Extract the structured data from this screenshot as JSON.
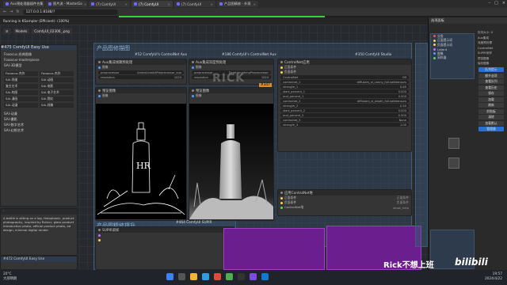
{
  "browser": {
    "tabs": [
      {
        "label": "Aux预处理器插件合集"
      },
      {
        "label": "图片流 - MasterGo"
      },
      {
        "label": "(7) ComfyUI"
      },
      {
        "label": "(7) ComfyUI",
        "active": true
      },
      {
        "label": "(7) ComfyUI"
      },
      {
        "label": "产品图精修 - 外观"
      }
    ],
    "url": "127.0.0.1:8188/?"
  },
  "app": {
    "title_line": "Running in KSampler (Efficient): (100%)",
    "model_label": "Models",
    "model_value": "ComfyUI_02306_.png"
  },
  "canvas": {
    "group_main": "产品图修描图",
    "group_bottom": "产品图精修提升",
    "node_475": "#475 ComfyUI Easy Use",
    "node_472": "#472 ComfyUI Easy Use",
    "node_52": "#52 ComfyUI's ControlNet Aux",
    "node_52_title": "Aux集成线稿预处理",
    "node_52_fields": [
      {
        "name": "图像",
        "value": ""
      },
      {
        "name": "preprocessor",
        "value": "AnimeLineArtPreprocessor_aux"
      },
      {
        "name": "resolution",
        "value": "1024"
      }
    ],
    "node_186": "#186 ComfyUI's ControlNet Aux",
    "node_186_title": "Aux集成深度预处理",
    "node_186_fields": [
      {
        "name": "图像",
        "value": ""
      },
      {
        "name": "preprocessor",
        "value": "DepthAnythingPreprocessor"
      },
      {
        "name": "resolution",
        "value": "1024"
      }
    ],
    "preview_title": "预览图像",
    "preview_title2": "预览图像",
    "preview_label": "图像",
    "node_350": "#350 ComfyUI Studio",
    "node_350_title": "ControlNet应用",
    "node_350_fields": [
      {
        "name": "正面条件",
        "value": ""
      },
      {
        "name": "负面条件",
        "value": ""
      },
      {
        "name": "ControlNet",
        "value": "Off"
      },
      {
        "name": "controlnet_1",
        "value": "diffusers_xl_canny_full.safetensors"
      },
      {
        "name": "strength_1",
        "value": "0.60"
      },
      {
        "name": "start_percent_1",
        "value": "0.000"
      },
      {
        "name": "end_percent_1",
        "value": "0.500"
      },
      {
        "name": "controlnet_2",
        "value": "diffusers_xl_depth_full.safetensors"
      },
      {
        "name": "strength_2",
        "value": "0.50"
      },
      {
        "name": "start_percent_2",
        "value": "0.000"
      },
      {
        "name": "end_percent_2",
        "value": "0.500"
      },
      {
        "name": "controlnet_3",
        "value": "None"
      },
      {
        "name": "strength_3",
        "value": "1.00"
      }
    ],
    "node_350b_title": "应用ControlNet堆",
    "node_350b_fields": [
      {
        "name": "正面条件",
        "value": "正面条件"
      },
      {
        "name": "负面条件",
        "value": "负面条件"
      },
      {
        "name": "ControlNet堆",
        "value": "show_help"
      }
    ],
    "node_464": "#464 ComfyUI SUPIR",
    "node_464_title": "SUPIR采样",
    "node_347": "#347",
    "left_list": [
      "Fooocus 经典图像",
      "Fooocus-masterpiece",
      "SAI-3D模型",
      "SAI-动漫",
      "SAI-摄影",
      "SAI-数字艺术",
      "SAI-幻想艺术"
    ],
    "left_buttons": [
      "Fooocus-杰作",
      "Fooocus-杰作",
      "SAI-线描",
      "SAI-动画",
      "复古艺术",
      "SAI-电影",
      "SAI-构图",
      "SAI-电子艺术",
      "SAI-漫画",
      "SAI-霓虹",
      "SAI-动漫",
      "SAI-线稿"
    ],
    "prompt_text": "A bottle is sitting on a log, theophanic, product photography, inspired by Rainer, glass product introduction photo, official product photo, ad design, minimal digital render"
  },
  "watermark": "Rick不想上班",
  "sidebar": {
    "header": "选项面板",
    "items": [
      "分类",
      "正面提示词",
      "负面提示词",
      "Latent",
      "图像",
      "采样器"
    ],
    "buttons": [
      "队列提示",
      "额外选项",
      "查看队列",
      "查看历史",
      "保存",
      "加载",
      "刷新",
      "剪贴板",
      "清除",
      "加载默认",
      "管理器"
    ],
    "queue_title": "队列大小: 0",
    "queue_items": [
      "Aux集成",
      "深度预处理",
      "ControlNet",
      "SUPIR采样",
      "预览图像",
      "保存图像"
    ]
  },
  "taskbar": {
    "weather_temp": "20°C",
    "weather_desc": "大部晴朗",
    "time": "19:57",
    "date": "2024/4/22"
  },
  "brand": "Rick不想上班",
  "bilibili": "bilibili"
}
